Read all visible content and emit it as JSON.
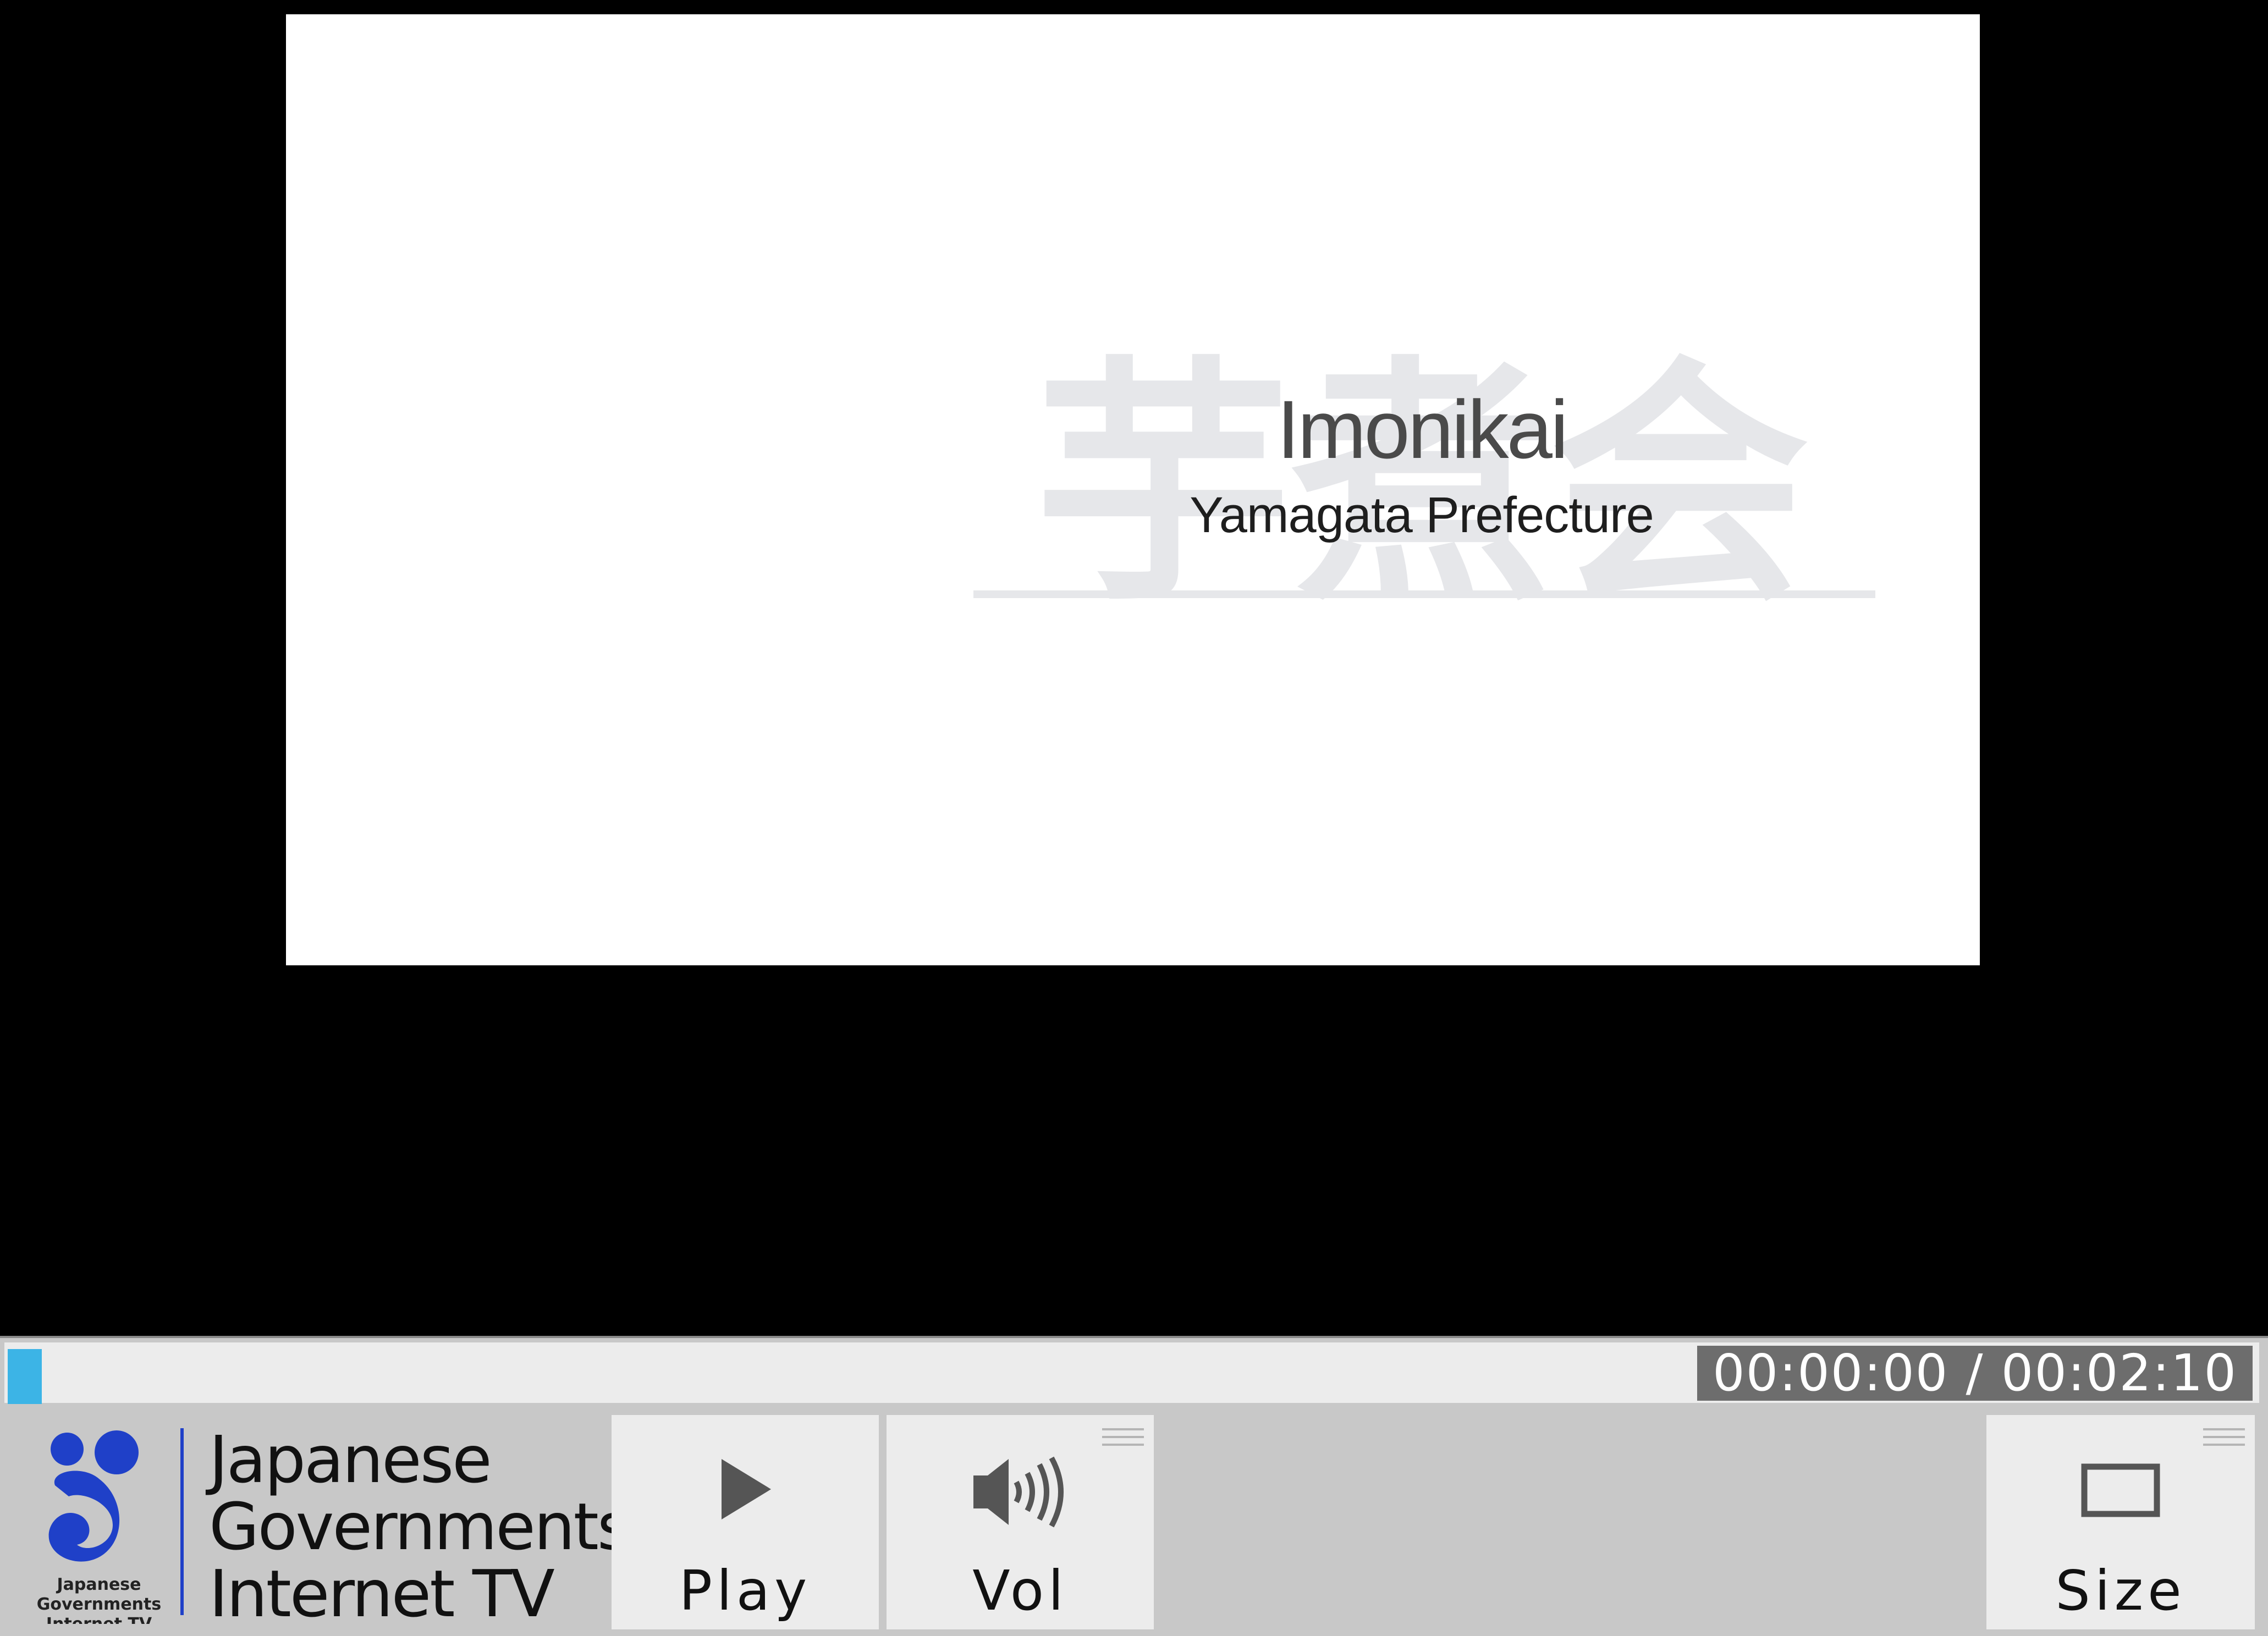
{
  "video": {
    "title": "Imonikai",
    "subtitle": "Yamagata Prefecture",
    "watermark": "芋煮会"
  },
  "player": {
    "time_current": "00:00:00",
    "time_separator": "/",
    "time_total": "00:02:10",
    "time_display": "00:00:00 / 00:02:10",
    "progress_fraction": 0.0,
    "accent_color": "#3cb4e6"
  },
  "logo": {
    "emblem_icon": "gov-internet-tv-emblem-icon",
    "emblem_caption": [
      "Japanese",
      "Governments",
      "Internet TV"
    ],
    "lines": [
      "Japanese",
      "Governments",
      "Internet TV"
    ],
    "brand_color": "#1f40c8"
  },
  "controls": {
    "play": {
      "label": "Play",
      "icon": "play-icon"
    },
    "volume": {
      "label": "Vol",
      "icon": "speaker-icon"
    },
    "size": {
      "label": "Size",
      "icon": "screen-size-icon"
    }
  }
}
